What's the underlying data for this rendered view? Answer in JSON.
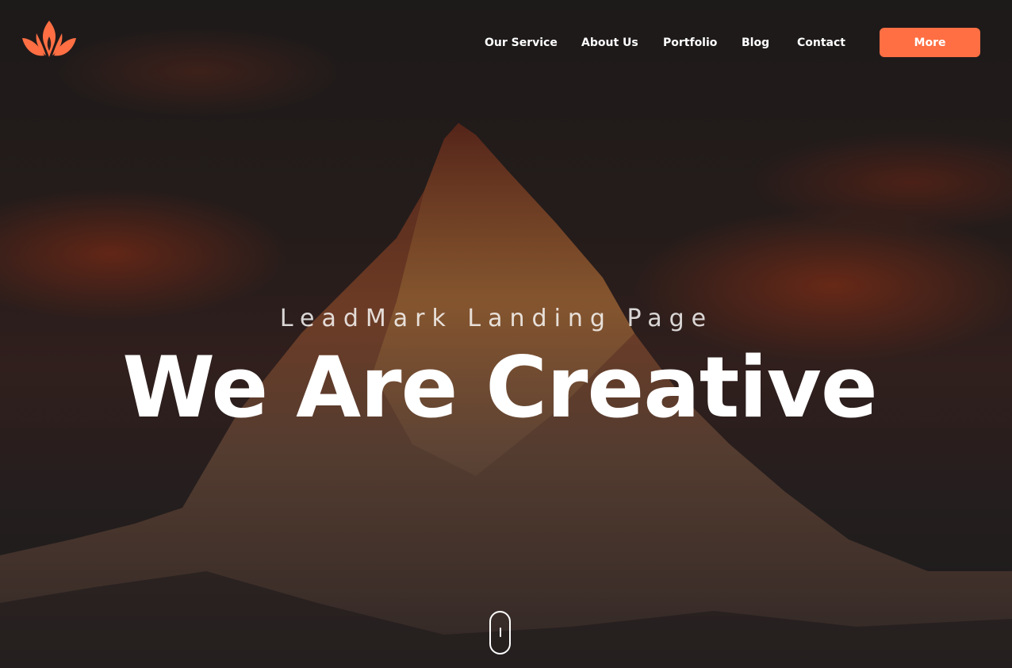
{
  "brand": {
    "logo_icon": "lotus-flame-icon",
    "accent_color": "#ff6f43"
  },
  "nav": {
    "items": [
      {
        "label": "Our Service"
      },
      {
        "label": "About Us"
      },
      {
        "label": "Portfolio"
      },
      {
        "label": "Blog"
      },
      {
        "label": "Contact"
      }
    ],
    "cta_label": "More"
  },
  "hero": {
    "subtitle": "LeadMark Landing Page",
    "headline": "We Are Creative",
    "scroll_icon": "mouse-scroll-icon"
  }
}
